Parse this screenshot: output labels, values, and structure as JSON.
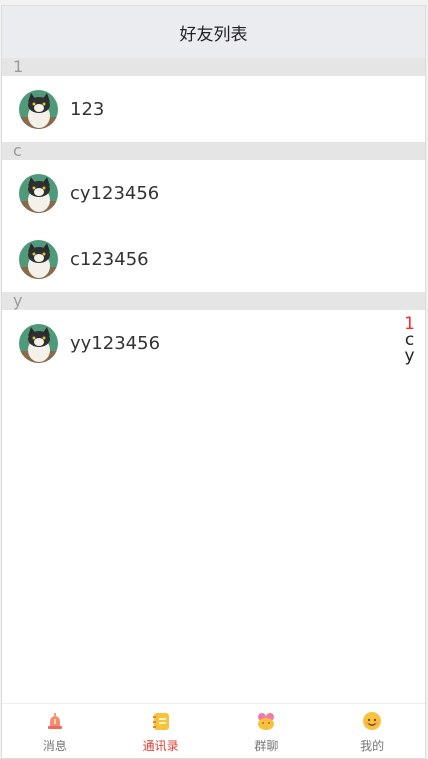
{
  "header": {
    "title": "好友列表"
  },
  "groups": [
    {
      "letter": "1",
      "items": [
        {
          "name": "123"
        }
      ]
    },
    {
      "letter": "c",
      "items": [
        {
          "name": "cy123456"
        },
        {
          "name": "c123456"
        }
      ]
    },
    {
      "letter": "y",
      "items": [
        {
          "name": "yy123456"
        }
      ]
    }
  ],
  "index_bar": {
    "letters": [
      "1",
      "c",
      "y"
    ],
    "active_color": "#ff2a2a",
    "inactive_color": "#222222"
  },
  "tabbar": {
    "tabs": [
      {
        "label": "消息",
        "icon": "alarm-bell-icon"
      },
      {
        "label": "通讯录",
        "icon": "notebook-icon",
        "active": true
      },
      {
        "label": "群聊",
        "icon": "group-chat-icon"
      },
      {
        "label": "我的",
        "icon": "smiley-face-icon"
      }
    ],
    "active_color": "#e43d33"
  }
}
